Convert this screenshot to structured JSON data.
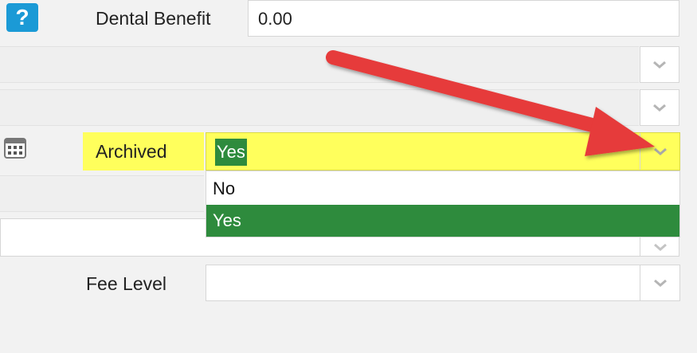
{
  "top": {
    "help_glyph": "?",
    "dental_label": "Dental Benefit",
    "dental_value": "0.00"
  },
  "archived": {
    "label": "Archived",
    "value": "Yes",
    "options": [
      "No",
      "Yes"
    ],
    "selected": "Yes"
  },
  "fee_level": {
    "label": "Fee Level",
    "value": ""
  },
  "colors": {
    "highlight": "#ffff5c",
    "selected_option": "#2e8b3d",
    "arrow": "#e63a3a",
    "help_icon": "#1b9ad6"
  },
  "icons": [
    "help-icon",
    "calendar-icon",
    "chevron-down-icon",
    "red-arrow-annotation"
  ]
}
